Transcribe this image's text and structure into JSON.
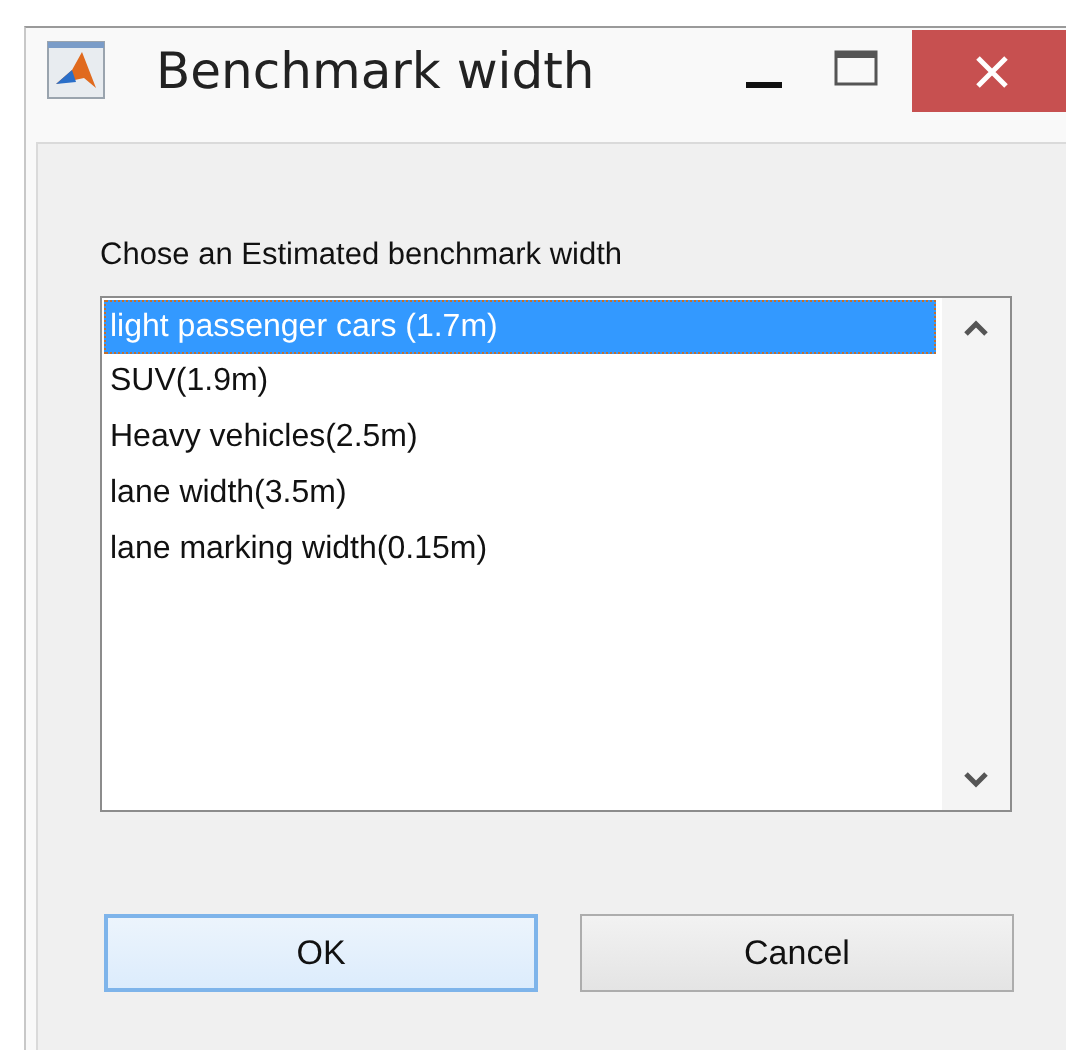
{
  "window": {
    "title": "Benchmark width"
  },
  "prompt": "Chose an Estimated benchmark width",
  "list": {
    "items": [
      {
        "label": "light passenger cars (1.7m)",
        "selected": true
      },
      {
        "label": "SUV(1.9m)",
        "selected": false
      },
      {
        "label": "Heavy vehicles(2.5m)",
        "selected": false
      },
      {
        "label": "lane width(3.5m)",
        "selected": false
      },
      {
        "label": "lane marking width(0.15m)",
        "selected": false
      }
    ]
  },
  "buttons": [
    {
      "label": "OK",
      "focused": true
    },
    {
      "label": "Cancel",
      "focused": false
    }
  ]
}
